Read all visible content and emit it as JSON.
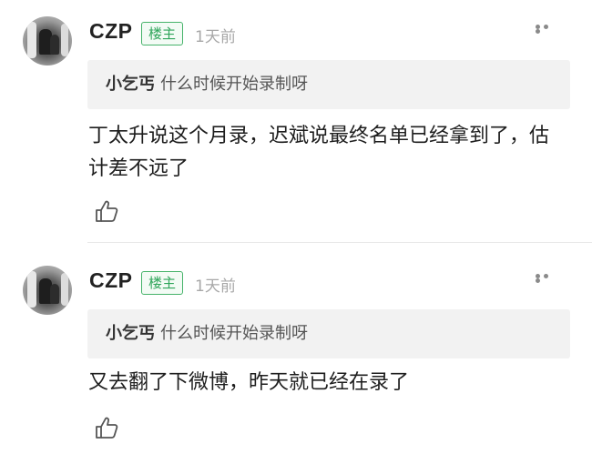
{
  "comments": [
    {
      "username": "CZP",
      "badge": "楼主",
      "time": "1天前",
      "quote_name": "小乞丐",
      "quote_text": "什么时候开始录制呀",
      "body": "丁太升说这个月录，迟斌说最终名单已经拿到了，估计差不远了"
    },
    {
      "username": "CZP",
      "badge": "楼主",
      "time": "1天前",
      "quote_name": "小乞丐",
      "quote_text": "什么时候开始录制呀",
      "body": "又去翻了下微博，昨天就已经在录了"
    }
  ],
  "icons": {
    "more": "more-dots-icon",
    "like": "thumbs-up-icon",
    "avatar": "avatar-image"
  },
  "colors": {
    "badge_green": "#2fa55a",
    "quote_bg": "#f2f2f2",
    "time_gray": "#a8a8a8"
  }
}
